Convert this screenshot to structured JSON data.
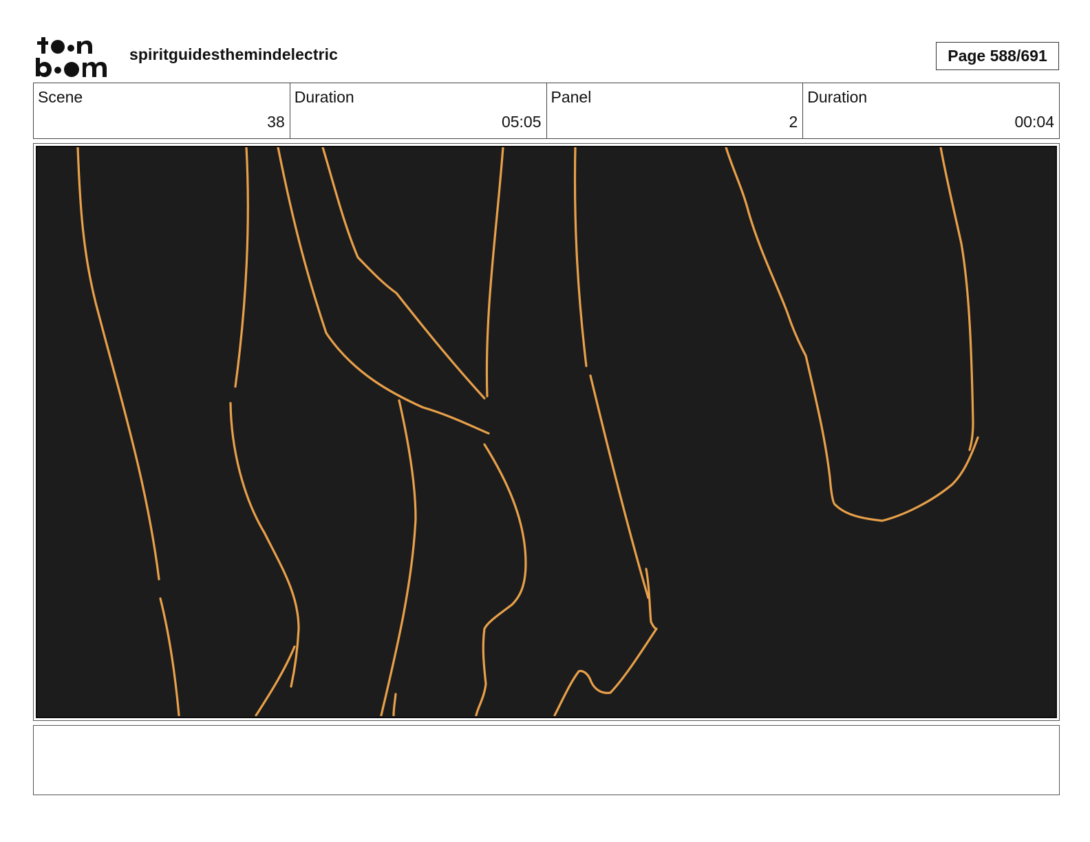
{
  "header": {
    "logo_name": "toonboom-logo",
    "logo_top": "to●n",
    "logo_bottom": "b●●m",
    "project_title": "spiritguidesthemindelectric",
    "page_label": "Page 588/691"
  },
  "info": {
    "scene_label": "Scene",
    "scene_value": "38",
    "scene_duration_label": "Duration",
    "scene_duration_value": "05:05",
    "panel_label": "Panel",
    "panel_value": "2",
    "panel_duration_label": "Duration",
    "panel_duration_value": "00:04"
  },
  "panel": {
    "background_color": "#1c1c1c",
    "line_color": "#e8a04a"
  },
  "notes": {
    "text": ""
  }
}
